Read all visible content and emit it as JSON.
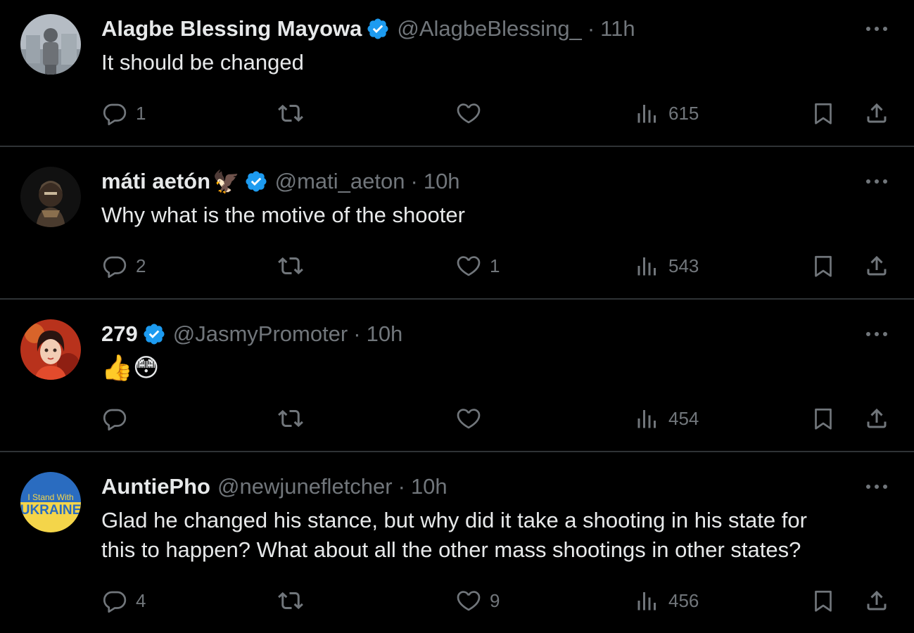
{
  "tweets": [
    {
      "name": "Alagbe Blessing Mayowa",
      "verified": true,
      "handle": "@AlagbeBlessing_",
      "time": "11h",
      "text": "It should be changed",
      "replies": "1",
      "retweets": "",
      "likes": "",
      "views": "615"
    },
    {
      "name": "máti aetón",
      "name_emoji": "🦅",
      "verified": true,
      "handle": "@mati_aeton",
      "time": "10h",
      "text": "Why what is the motive of the shooter",
      "replies": "2",
      "retweets": "",
      "likes": "1",
      "views": "543"
    },
    {
      "name": "279",
      "verified": true,
      "handle": "@JasmyPromoter",
      "time": "10h",
      "text": "👍😳",
      "replies": "",
      "retweets": "",
      "likes": "",
      "views": "454"
    },
    {
      "name": "AuntiePho",
      "verified": false,
      "handle": "@newjunefletcher",
      "time": "10h",
      "text_line1": "Glad he changed his stance, but why did it take a shooting in his state for",
      "text_line2": "this to happen? What about all the other mass shootings in other states?",
      "avatar_text_top": "I Stand With",
      "avatar_text_bottom": "UKRAINE",
      "replies": "4",
      "retweets": "",
      "likes": "9",
      "views": "456"
    }
  ],
  "separator": "·",
  "colors": {
    "background": "#000000",
    "text_primary": "#e7e9ea",
    "text_secondary": "#71767b",
    "verified_blue": "#1d9bf0",
    "divider": "#2f3336"
  },
  "icons": {
    "reply": "reply-icon",
    "retweet": "retweet-icon",
    "like": "heart-icon",
    "views": "views-icon",
    "bookmark": "bookmark-icon",
    "share": "share-icon",
    "more": "more-options-icon",
    "verified": "verified-badge-icon"
  }
}
